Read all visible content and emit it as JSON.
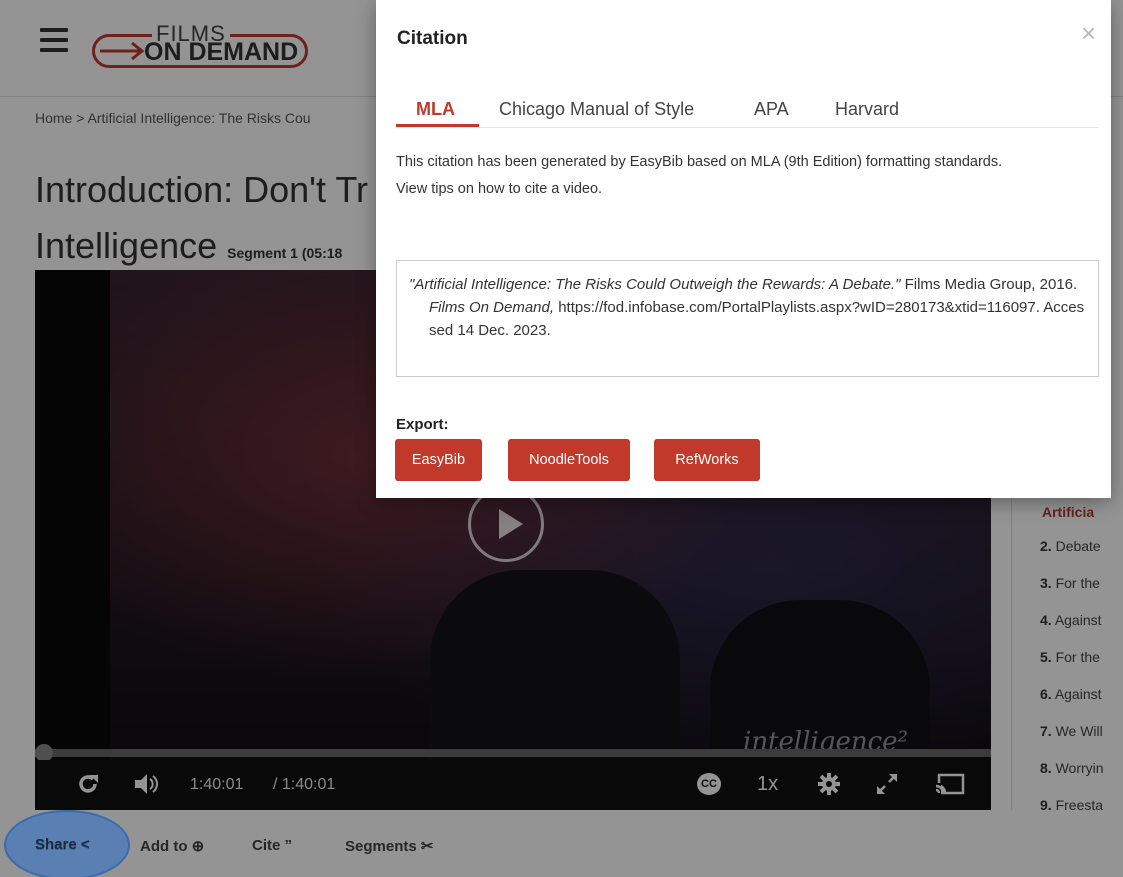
{
  "header": {
    "logo_top": "FILMS",
    "logo_bottom": "ON DEMAND"
  },
  "breadcrumb": "Home > Artificial Intelligence: The Risks Cou",
  "title": {
    "line1": "Introduction: Don't Tr",
    "line2": "Intelligence",
    "segment": "Segment 1 (05:18"
  },
  "video": {
    "time_current": "1:40:01",
    "time_total": "/ 1:40:01",
    "speed": "1x",
    "cc": "CC",
    "watermark": "intelligence²",
    "progress": 0
  },
  "sidebar": {
    "active_item": "Artificia",
    "items": [
      {
        "num": "2.",
        "label": "Debate"
      },
      {
        "num": "3.",
        "label": "For the"
      },
      {
        "num": "4.",
        "label": "Against"
      },
      {
        "num": "5.",
        "label": "For the"
      },
      {
        "num": "6.",
        "label": "Against"
      },
      {
        "num": "7.",
        "label": "We Will"
      },
      {
        "num": "8.",
        "label": "Worryin"
      },
      {
        "num": "9.",
        "label": "Freesta"
      }
    ]
  },
  "actions": {
    "share": "Share",
    "add_to": "Add to",
    "cite": "Cite",
    "segments": "Segments"
  },
  "modal": {
    "title": "Citation",
    "close": "×",
    "tabs": [
      "MLA",
      "Chicago Manual of Style",
      "APA",
      "Harvard"
    ],
    "active_tab": "MLA",
    "description_line1": "This citation has been generated by EasyBib based on MLA (9th Edition) formatting standards.",
    "description_line2": "View tips on how to cite a video.",
    "citation_title": "\"Artificial Intelligence: The Risks Could Outweigh the Rewards: A Debate.\"",
    "citation_publisher": " Films Media Group, 2016. ",
    "citation_container": "Films On Demand,",
    "citation_rest": " https://fod.infobase.com/PortalPlaylists.aspx?wID=280173&xtid=116097. Accessed 14 Dec. 2023.",
    "export_label": "Export:",
    "export_buttons": [
      "EasyBib",
      "NoodleTools",
      "RefWorks"
    ]
  },
  "colors": {
    "accent": "#c0392b",
    "highlight": "#3a6bb0"
  }
}
